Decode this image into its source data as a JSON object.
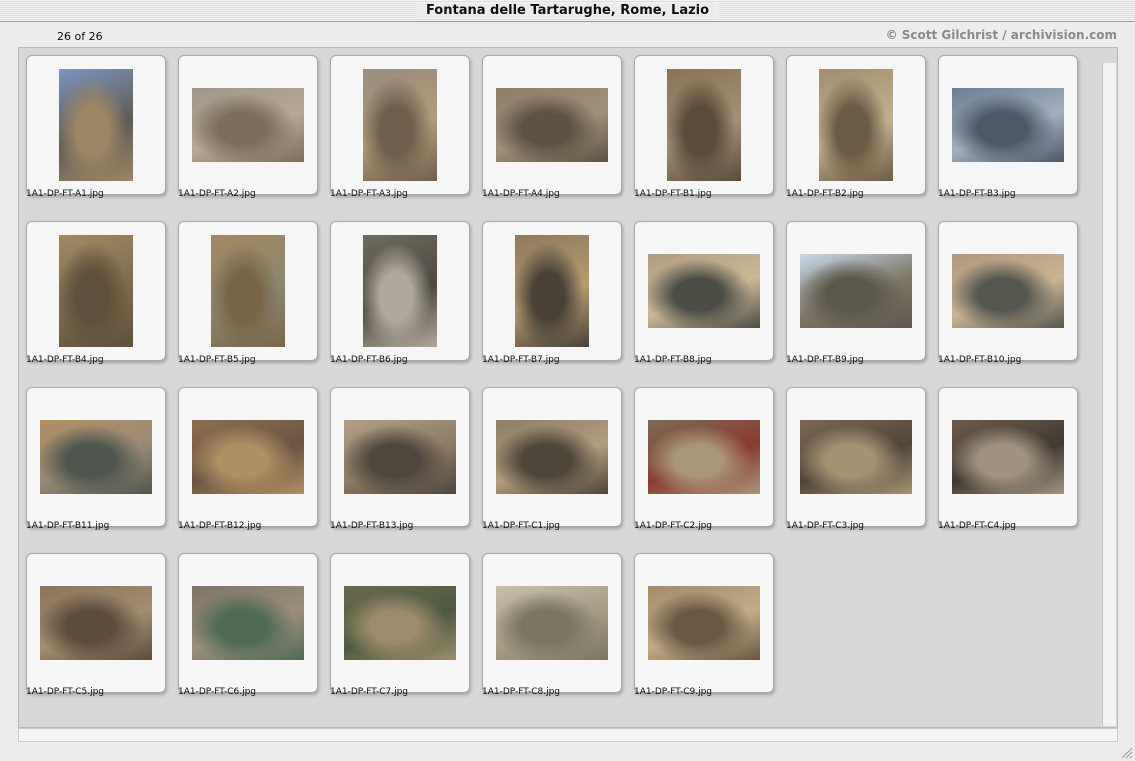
{
  "window": {
    "title": "Fontana delle Tartarughe, Rome, Lazio"
  },
  "header": {
    "count": "26 of 26",
    "credit": "© Scott Gilchrist / archivision.com"
  },
  "thumbnails": [
    {
      "filename": "1A1-DP-FT-A1.jpg",
      "orientation": "portrait",
      "colors": [
        "#7d95c0",
        "#9d8663",
        "#5e5a55"
      ]
    },
    {
      "filename": "1A1-DP-FT-A2.jpg",
      "orientation": "landscape",
      "colors": [
        "#9e958b",
        "#7d6d5a",
        "#b7a893"
      ]
    },
    {
      "filename": "1A1-DP-FT-A3.jpg",
      "orientation": "portrait",
      "colors": [
        "#9a8d80",
        "#6f604c",
        "#b19a77"
      ]
    },
    {
      "filename": "1A1-DP-FT-A4.jpg",
      "orientation": "landscape",
      "colors": [
        "#8e7f69",
        "#5e5244",
        "#a09078"
      ]
    },
    {
      "filename": "1A1-DP-FT-B1.jpg",
      "orientation": "portrait",
      "colors": [
        "#8a7256",
        "#5b4c3a",
        "#a39277"
      ]
    },
    {
      "filename": "1A1-DP-FT-B2.jpg",
      "orientation": "portrait",
      "colors": [
        "#9f8d6d",
        "#6c5c45",
        "#c2b08d"
      ]
    },
    {
      "filename": "1A1-DP-FT-B3.jpg",
      "orientation": "landscape",
      "colors": [
        "#6b7d96",
        "#4d5969",
        "#a3b0bd"
      ]
    },
    {
      "filename": "1A1-DP-FT-B4.jpg",
      "orientation": "portrait",
      "colors": [
        "#a28a62",
        "#5e503a",
        "#7d6a4d"
      ]
    },
    {
      "filename": "1A1-DP-FT-B5.jpg",
      "orientation": "portrait",
      "colors": [
        "#a4895c",
        "#7a6647",
        "#8c8672"
      ]
    },
    {
      "filename": "1A1-DP-FT-B6.jpg",
      "orientation": "portrait",
      "colors": [
        "#6f6a5f",
        "#b0a89a",
        "#4e4a42"
      ]
    },
    {
      "filename": "1A1-DP-FT-B7.jpg",
      "orientation": "portrait",
      "colors": [
        "#8f7a5c",
        "#4a4237",
        "#b69b6f"
      ]
    },
    {
      "filename": "1A1-DP-FT-B8.jpg",
      "orientation": "landscape",
      "colors": [
        "#b19c80",
        "#4b4d45",
        "#cdb896"
      ]
    },
    {
      "filename": "1A1-DP-FT-B9.jpg",
      "orientation": "landscape",
      "colors": [
        "#c7d8ea",
        "#5c584b",
        "#7d7666"
      ]
    },
    {
      "filename": "1A1-DP-FT-B10.jpg",
      "orientation": "landscape",
      "colors": [
        "#b0977c",
        "#55574f",
        "#cbb493"
      ]
    },
    {
      "filename": "1A1-DP-FT-B11.jpg",
      "orientation": "landscape",
      "colors": [
        "#b38f63",
        "#4f564d",
        "#9a8a74"
      ]
    },
    {
      "filename": "1A1-DP-FT-B12.jpg",
      "orientation": "landscape",
      "colors": [
        "#8e6e4d",
        "#b08f64",
        "#6c5642"
      ]
    },
    {
      "filename": "1A1-DP-FT-B13.jpg",
      "orientation": "landscape",
      "colors": [
        "#b29f85",
        "#4e463c",
        "#8d7b63"
      ]
    },
    {
      "filename": "1A1-DP-FT-C1.jpg",
      "orientation": "landscape",
      "colors": [
        "#8f7e65",
        "#4d4538",
        "#b19c7d"
      ]
    },
    {
      "filename": "1A1-DP-FT-C2.jpg",
      "orientation": "landscape",
      "colors": [
        "#7e6c54",
        "#a9957b",
        "#8a3b2e"
      ]
    },
    {
      "filename": "1A1-DP-FT-C3.jpg",
      "orientation": "landscape",
      "colors": [
        "#7e6853",
        "#a79273",
        "#4f4538"
      ]
    },
    {
      "filename": "1A1-DP-FT-C4.jpg",
      "orientation": "landscape",
      "colors": [
        "#6e5a4b",
        "#a1937f",
        "#413a33"
      ]
    },
    {
      "filename": "1A1-DP-FT-C5.jpg",
      "orientation": "landscape",
      "colors": [
        "#8d7258",
        "#5d4c3b",
        "#a48e72"
      ]
    },
    {
      "filename": "1A1-DP-FT-C6.jpg",
      "orientation": "landscape",
      "colors": [
        "#7e7365",
        "#4f6b55",
        "#9d8f7c"
      ]
    },
    {
      "filename": "1A1-DP-FT-C7.jpg",
      "orientation": "landscape",
      "colors": [
        "#6d6a4e",
        "#9c8b6c",
        "#4e5a40"
      ]
    },
    {
      "filename": "1A1-DP-FT-C8.jpg",
      "orientation": "landscape",
      "colors": [
        "#c8bfa9",
        "#7b7560",
        "#a59c84"
      ]
    },
    {
      "filename": "1A1-DP-FT-C9.jpg",
      "orientation": "landscape",
      "colors": [
        "#a58b69",
        "#6a5843",
        "#c2ab86"
      ]
    }
  ]
}
